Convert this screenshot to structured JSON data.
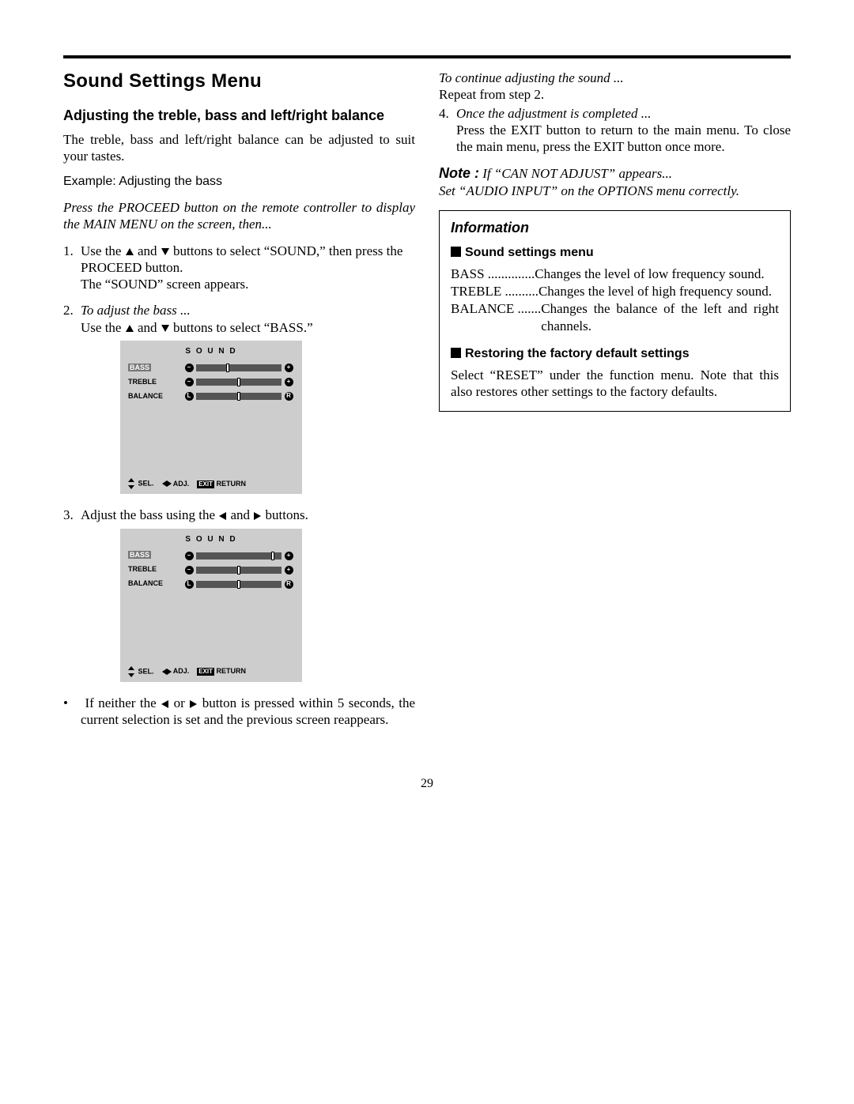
{
  "section_title": "Sound Settings Menu",
  "left": {
    "subheading": "Adjusting the treble, bass and left/right balance",
    "intro": "The treble, bass and left/right balance can be adjusted to suit your tastes.",
    "example_label": "Example: Adjusting the bass",
    "press_proceed_a": "Press the PROCEED button on the remote controller to display the MAIN MENU on the screen, then...",
    "step1_a": "Use the ",
    "step1_b": " and ",
    "step1_c": " buttons to select “SOUND,” then press the PROCEED button.",
    "step1_d": "The “SOUND” screen appears.",
    "step2_head": "To adjust the bass ...",
    "step2_a": "Use the ",
    "step2_b": " and ",
    "step2_c": " buttons to select “BASS.”",
    "step3_a": "Adjust the bass using the ",
    "step3_b": " and ",
    "step3_c": " buttons.",
    "bullet_a": "If neither the ",
    "bullet_b": " or ",
    "bullet_c": " button is pressed within 5 seconds, the current selection is set and the previous screen reappears."
  },
  "osd": {
    "title": "S O U N D",
    "rows": {
      "bass": "BASS",
      "treble": "TREBLE",
      "balance": "BALANCE"
    },
    "sym_minus": "–",
    "sym_plus": "+",
    "sym_L": "L",
    "sym_R": "R",
    "footer_sel": "SEL.",
    "footer_adj": "ADJ.",
    "footer_exit": "EXIT",
    "footer_return": "RETURN"
  },
  "right": {
    "cont_head": "To continue adjusting the sound ...",
    "cont_body": "Repeat from step 2.",
    "step4_head": "Once the adjustment is completed ...",
    "step4_body": "Press the EXIT button to return to the main menu. To close the main menu, press the EXIT button once more.",
    "note_label": "Note :",
    "note_line1": " If “CAN NOT ADJUST” appears...",
    "note_line2": "Set “AUDIO INPUT” on the OPTIONS menu correctly.",
    "info_title": "Information",
    "info_sub1": "Sound settings menu",
    "def_bass_t": "BASS ..............",
    "def_bass_d": "Changes the level of low frequency sound.",
    "def_treble_t": "TREBLE ..........",
    "def_treble_d": "Changes the level of high frequency sound.",
    "def_balance_t": "BALANCE .......",
    "def_balance_d": "Changes the balance of the left and right channels.",
    "info_sub2": "Restoring the factory default settings",
    "reset_body": "Select “RESET” under the function menu. Note that this also restores other settings to the factory defaults."
  },
  "page_number": "29"
}
